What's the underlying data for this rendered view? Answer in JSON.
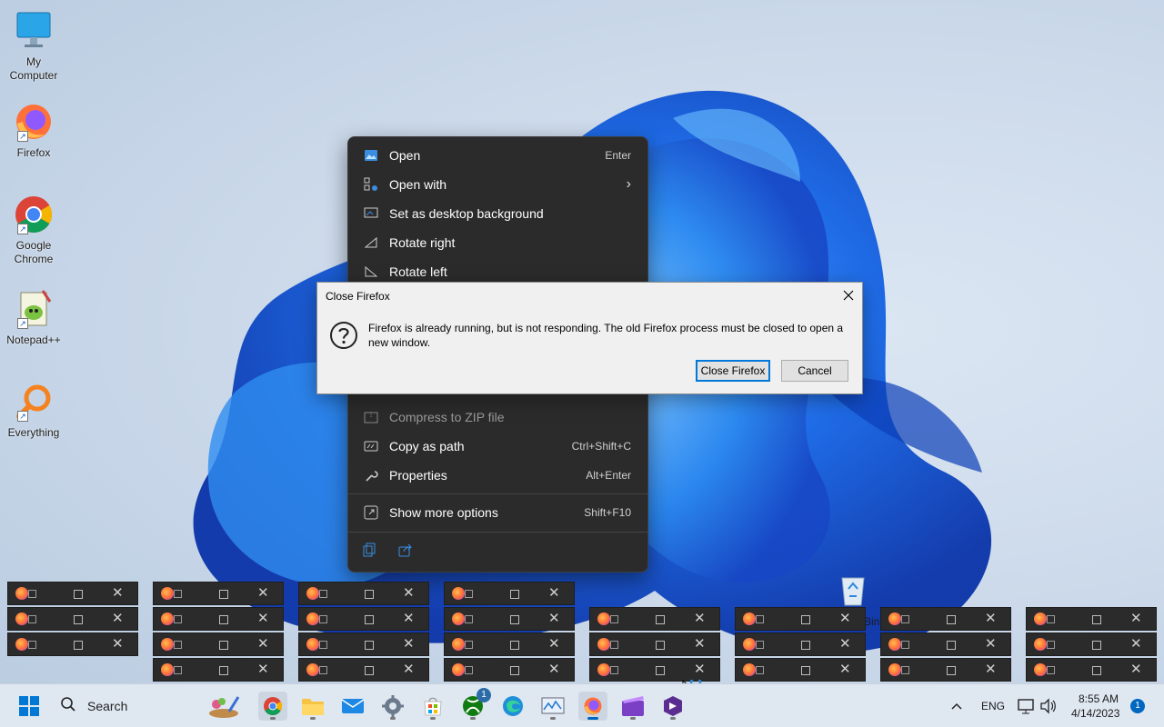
{
  "desktop": {
    "icons": [
      {
        "label": "My Computer",
        "icon": "monitor-icon"
      },
      {
        "label": "Firefox",
        "icon": "firefox-icon"
      },
      {
        "label": "Google Chrome",
        "icon": "chrome-icon"
      },
      {
        "label": "Notepad++",
        "icon": "notepadpp-icon"
      },
      {
        "label": "Everything",
        "icon": "everything-icon"
      }
    ],
    "recycle_bin_partial_label": "Bin"
  },
  "context_menu": {
    "items": [
      {
        "label": "Open",
        "shortcut": "Enter",
        "icon": "photo-icon"
      },
      {
        "label": "Open with",
        "shortcut": "",
        "icon": "apps-icon",
        "submenu": true
      },
      {
        "label": "Set as desktop background",
        "shortcut": "",
        "icon": "desktop-background-icon"
      },
      {
        "label": "Rotate right",
        "shortcut": "",
        "icon": "rotate-right-icon"
      },
      {
        "label": "Rotate left",
        "shortcut": "",
        "icon": "rotate-left-icon"
      },
      {
        "label": "Compress to ZIP file",
        "shortcut": "",
        "icon": "zip-icon"
      },
      {
        "label": "Copy as path",
        "shortcut": "Ctrl+Shift+C",
        "icon": "copy-path-icon"
      },
      {
        "label": "Properties",
        "shortcut": "Alt+Enter",
        "icon": "wrench-icon"
      },
      {
        "label": "Show more options",
        "shortcut": "Shift+F10",
        "icon": "more-options-icon"
      }
    ],
    "bottom_actions": [
      "copy-icon",
      "share-icon"
    ]
  },
  "dialog": {
    "title": "Close Firefox",
    "message": "Firefox is already running, but is not responding. The old Firefox process must be closed to open a new window.",
    "primary_button": "Close Firefox",
    "cancel_button": "Cancel"
  },
  "taskbar": {
    "search_label": "Search",
    "apps": [
      "copilot-brush-icon",
      "chrome-icon",
      "file-explorer-icon",
      "mail-icon",
      "settings-icon",
      "store-icon",
      "xbox-icon",
      "edge-icon",
      "resource-monitor-icon",
      "firefox-icon",
      "clipchamp-icon",
      "visual-studio-icon"
    ],
    "xbox_badge": "1",
    "language": "ENG",
    "time": "8:55 AM",
    "date": "4/14/2023",
    "notification_count": "1"
  },
  "colors": {
    "menu_bg": "#2b2b2b",
    "accent": "#0078d7",
    "taskbar_bg": "#dfe7f1"
  }
}
